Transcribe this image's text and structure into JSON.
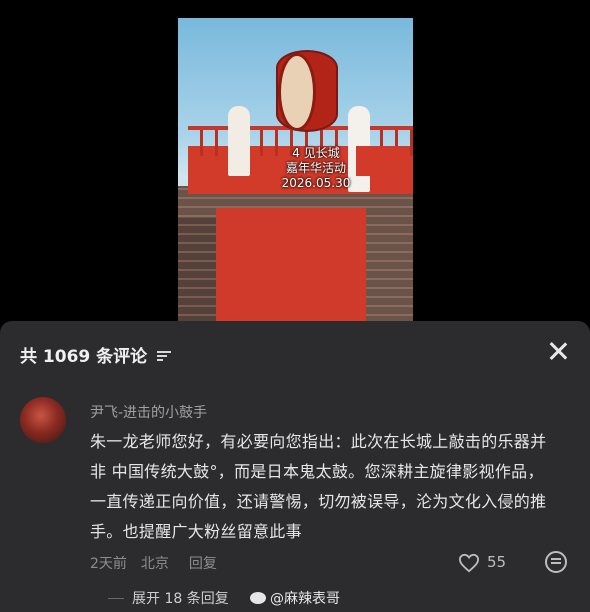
{
  "video": {
    "caption_line1": "4 见长城",
    "caption_line2": "嘉年华活动",
    "caption_line3": "2026.05.30"
  },
  "comments_panel": {
    "title": "共 1069 条评论"
  },
  "comment": {
    "username": "尹飞-进击的小鼓手",
    "text": "朱一龙老师您好，有必要向您指出：此次在长城上敲击的乐器并非 中国传统大鼓°，而是日本鬼太鼓。您深耕主旋律影视作品，一直传递正向价值，还请警惕，切勿被误导，沦为文化入侵的推手。也提醒广大粉丝留意此事",
    "time": "2天前",
    "location": "北京",
    "reply_label": "回复",
    "like_count": "55"
  },
  "expand": {
    "label": "展开 18 条回复"
  },
  "watermark": {
    "text": "@麻辣表哥"
  }
}
